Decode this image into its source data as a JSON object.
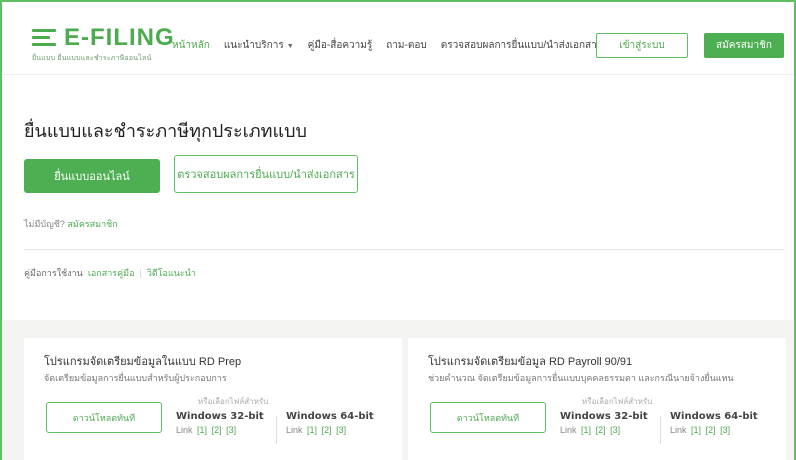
{
  "brand": {
    "name": "E-FILING",
    "subtitle": "ยื่นแบบ ยื่นแบบและชำระภาษีออนไลน์"
  },
  "nav": {
    "items": [
      {
        "label": "หน้าหลัก",
        "active": true
      },
      {
        "label": "แนะนำบริการ",
        "dropdown": true
      },
      {
        "label": "คู่มือ-สื่อความรู้"
      },
      {
        "label": "ถาม-ตอบ"
      },
      {
        "label": "ตรวจสอบผลการยื่นแบบ/นำส่งเอกสาร"
      }
    ],
    "login": "เข้าสู่ระบบ",
    "register": "สมัครสมาชิก"
  },
  "main": {
    "title": "ยื่นแบบและชำระภาษีทุกประเภทแบบ",
    "file_online": "ยื่นแบบออนไลน์",
    "check_status": "ตรวจสอบผลการยื่นแบบ/นำส่งเอกสาร",
    "no_account": "ไม่มีบัญชี?",
    "register_link": "สมัครสมาชิก",
    "manual_label": "คู่มือการใช้งาน",
    "manual_doc": "เอกสารคู่มือ",
    "manual_video": "วิดีโอแนะนำ"
  },
  "cards": [
    {
      "title": "โปรแกรมจัดเตรียมข้อมูลในแบบ RD Prep",
      "desc": "จัดเตรียมข้อมูลการยื่นแบบสำหรับผู้ประกอบการ",
      "download": "ดาวน์โหลดทันที",
      "choose": "หรือเลือกไฟล์สำหรับ",
      "os": [
        {
          "name": "Windows 32-bit",
          "link_prefix": "Link",
          "links": [
            "[1]",
            "[2]",
            "[3]"
          ]
        },
        {
          "name": "Windows 64-bit",
          "link_prefix": "Link",
          "links": [
            "[1]",
            "[2]",
            "[3]"
          ]
        }
      ]
    },
    {
      "title": "โปรแกรมจัดเตรียมข้อมูล RD Payroll 90/91",
      "desc": "ช่วยคำนวณ จัดเตรียมข้อมูลการยื่นแบบบุคคลธรรมดา และกรณีนายจ้างยื่นแทน",
      "download": "ดาวน์โหลดทันที",
      "choose": "หรือเลือกไฟล์สำหรับ",
      "os": [
        {
          "name": "Windows 32-bit",
          "link_prefix": "Link",
          "links": [
            "[1]",
            "[2]",
            "[3]"
          ]
        },
        {
          "name": "Windows 64-bit",
          "link_prefix": "Link",
          "links": [
            "[1]",
            "[2]",
            "[3]"
          ]
        }
      ]
    }
  ],
  "colors": {
    "accent": "#4dae52",
    "panel_bg": "#f4f4f2"
  }
}
